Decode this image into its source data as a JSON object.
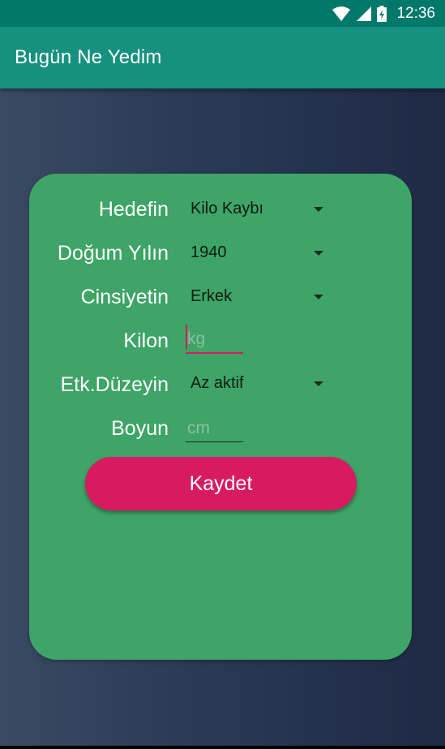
{
  "status_bar": {
    "time": "12:36",
    "icons": [
      "wifi-icon",
      "signal-icon",
      "battery-icon"
    ]
  },
  "app_bar": {
    "title": "Bugün Ne Yedim"
  },
  "form": {
    "goal": {
      "label": "Hedefin",
      "value": "Kilo Kaybı"
    },
    "birth_year": {
      "label": "Doğum Yılın",
      "value": "1940"
    },
    "gender": {
      "label": "Cinsiyetin",
      "value": "Erkek"
    },
    "weight": {
      "label": "Kilon",
      "value": "",
      "placeholder": "kg"
    },
    "activity": {
      "label": "Etk.Düzeyin",
      "value": "Az aktif"
    },
    "height": {
      "label": "Boyun",
      "value": "",
      "placeholder": "cm"
    },
    "save_label": "Kaydet"
  },
  "colors": {
    "status_bar": "#00796b",
    "app_bar": "#16917f",
    "card": "#3ea467",
    "accent": "#d81b60"
  }
}
